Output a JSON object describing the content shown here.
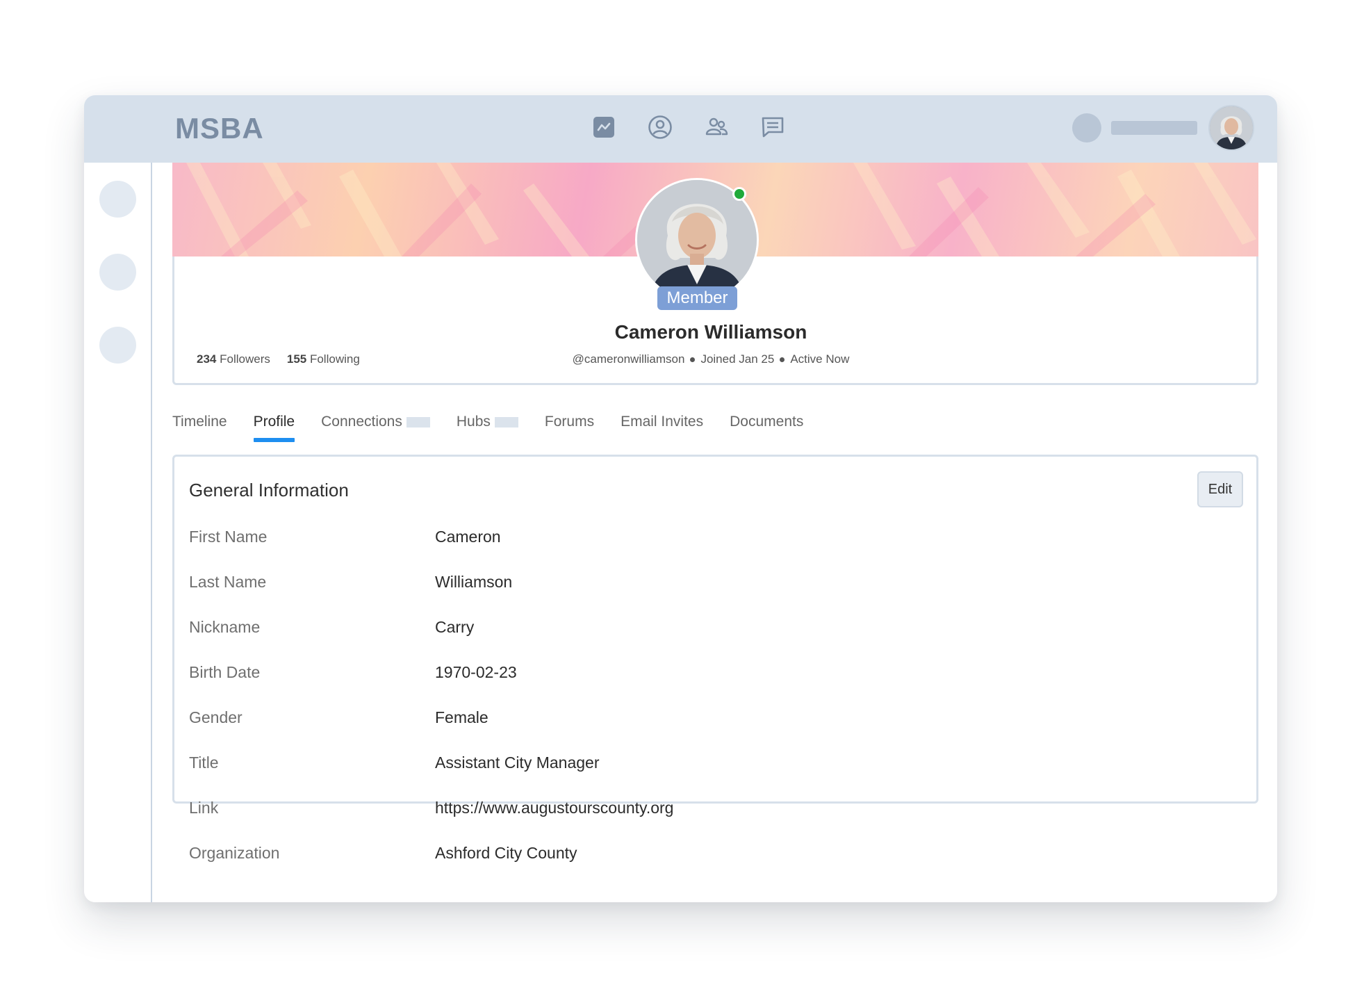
{
  "app": {
    "logo": "MSBA"
  },
  "topbar": {
    "icons": [
      "activity-icon",
      "user-circle-icon",
      "users-icon",
      "message-icon"
    ]
  },
  "profile": {
    "badge": "Member",
    "name": "Cameron Williamson",
    "followers_count": "234",
    "followers_label": "Followers",
    "following_count": "155",
    "following_label": "Following",
    "handle": "@cameronwilliamson",
    "joined": "Joined Jan 25",
    "status": "Active Now"
  },
  "tabs": [
    {
      "label": "Timeline"
    },
    {
      "label": "Profile",
      "active": true
    },
    {
      "label": "Connections"
    },
    {
      "label": "Hubs"
    },
    {
      "label": "Forums"
    },
    {
      "label": "Email Invites"
    },
    {
      "label": "Documents"
    }
  ],
  "general_info": {
    "title": "General Information",
    "edit_label": "Edit",
    "fields": [
      {
        "label": "First Name",
        "value": "Cameron"
      },
      {
        "label": "Last Name",
        "value": "Williamson"
      },
      {
        "label": "Nickname",
        "value": "Carry"
      },
      {
        "label": "Birth Date",
        "value": "1970-02-23"
      },
      {
        "label": "Gender",
        "value": "Female"
      },
      {
        "label": "Title",
        "value": "Assistant City Manager"
      },
      {
        "label": "Link",
        "value": "https://www.augustourscounty.org"
      },
      {
        "label": "Organization",
        "value": "Ashford City County"
      }
    ]
  },
  "colors": {
    "topbar": "#d6e0eb",
    "accent": "#1e8ef0",
    "badge": "#7d9fd6",
    "online": "#1faa3a"
  }
}
